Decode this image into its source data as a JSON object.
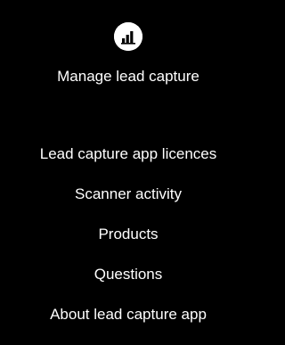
{
  "header": {
    "icon": "bar-chart-icon",
    "title": "Manage lead capture"
  },
  "menu": {
    "items": [
      {
        "label": "Lead capture app licences"
      },
      {
        "label": "Scanner activity"
      },
      {
        "label": "Products"
      },
      {
        "label": "Questions"
      },
      {
        "label": "About lead capture app"
      }
    ]
  },
  "colors": {
    "background": "#000000",
    "text": "#ffffff",
    "icon_circle": "#ffffff",
    "icon_glyph": "#000000"
  }
}
